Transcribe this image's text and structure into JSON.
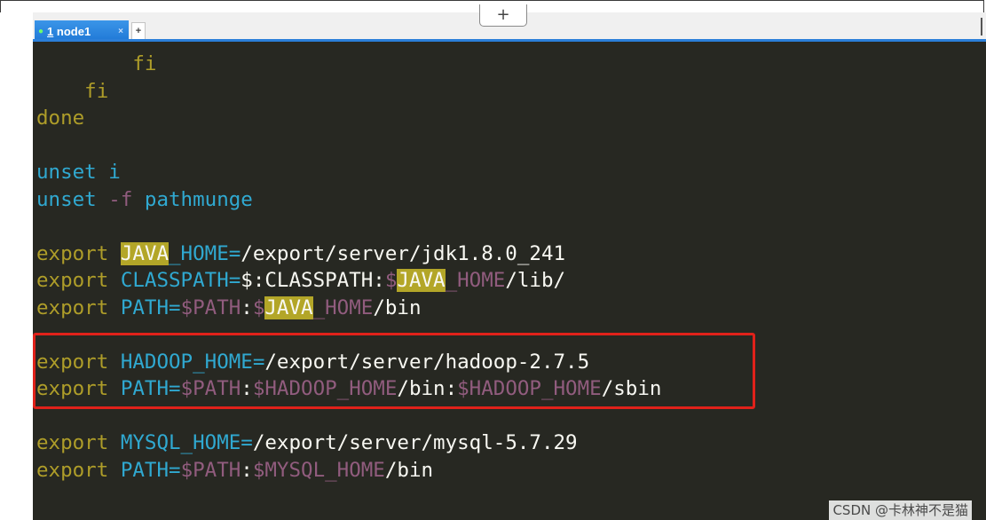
{
  "tabs": [
    {
      "number": "1",
      "name": " node1",
      "close": "×",
      "active": true
    }
  ],
  "new_tab_label": "+",
  "add_pane_label": "+",
  "terminal": {
    "lines": [
      [
        {
          "t": "        fi",
          "c": "kw"
        }
      ],
      [
        {
          "t": "    fi",
          "c": "kw"
        }
      ],
      [
        {
          "t": "done",
          "c": "kw"
        }
      ],
      [
        {
          "t": "",
          "c": "val"
        }
      ],
      [
        {
          "t": "unset ",
          "c": "cmd"
        },
        {
          "t": "i",
          "c": "cmd"
        }
      ],
      [
        {
          "t": "unset ",
          "c": "cmd"
        },
        {
          "t": "-f",
          "c": "var"
        },
        {
          "t": " pathmunge",
          "c": "cmd"
        }
      ],
      [
        {
          "t": "",
          "c": "val"
        }
      ],
      [
        {
          "t": "export ",
          "c": "kw"
        },
        {
          "t": "JAVA",
          "c": "hl"
        },
        {
          "t": "_HOME=",
          "c": "cmd"
        },
        {
          "t": "/export/server/jdk1.8.0_241",
          "c": "val"
        }
      ],
      [
        {
          "t": "export ",
          "c": "kw"
        },
        {
          "t": "CLASSPATH=",
          "c": "cmd"
        },
        {
          "t": "$:CLASSPATH:",
          "c": "val"
        },
        {
          "t": "$",
          "c": "var"
        },
        {
          "t": "JAVA",
          "c": "hl"
        },
        {
          "t": "_HOME",
          "c": "var"
        },
        {
          "t": "/lib/",
          "c": "val"
        }
      ],
      [
        {
          "t": "export ",
          "c": "kw"
        },
        {
          "t": "PATH=",
          "c": "cmd"
        },
        {
          "t": "$PATH",
          "c": "var"
        },
        {
          "t": ":",
          "c": "val"
        },
        {
          "t": "$",
          "c": "var"
        },
        {
          "t": "JAVA",
          "c": "hl"
        },
        {
          "t": "_HOME",
          "c": "var"
        },
        {
          "t": "/bin",
          "c": "val"
        }
      ],
      [
        {
          "t": "",
          "c": "val"
        }
      ],
      [
        {
          "t": "export ",
          "c": "kw"
        },
        {
          "t": "HADOOP_HOME=",
          "c": "cmd"
        },
        {
          "t": "/export/server/hadoop-2.7.5",
          "c": "val"
        }
      ],
      [
        {
          "t": "export ",
          "c": "kw"
        },
        {
          "t": "PATH=",
          "c": "cmd"
        },
        {
          "t": "$PATH",
          "c": "var"
        },
        {
          "t": ":",
          "c": "val"
        },
        {
          "t": "$HADOOP_HOME",
          "c": "var"
        },
        {
          "t": "/bin:",
          "c": "val"
        },
        {
          "t": "$HADOOP_HOME",
          "c": "var"
        },
        {
          "t": "/sbin",
          "c": "val"
        }
      ],
      [
        {
          "t": "",
          "c": "val"
        }
      ],
      [
        {
          "t": "export ",
          "c": "kw"
        },
        {
          "t": "MYSQL_HOME=",
          "c": "cmd"
        },
        {
          "t": "/export/server/mysql-5.7.29",
          "c": "val"
        }
      ],
      [
        {
          "t": "export ",
          "c": "kw"
        },
        {
          "t": "PATH=",
          "c": "cmd"
        },
        {
          "t": "$PATH",
          "c": "var"
        },
        {
          "t": ":",
          "c": "val"
        },
        {
          "t": "$MYSQL_HOME",
          "c": "var"
        },
        {
          "t": "/bin",
          "c": "val"
        }
      ]
    ]
  },
  "colors": {
    "terminal_bg": "#272822",
    "keyword": "#ae9d29",
    "command": "#30a9d1",
    "variable": "#915c7e",
    "search_highlight": "#b3a628",
    "annotation_box": "#e0211a",
    "tab_active": "#2b7fd9"
  },
  "watermark": "CSDN @卡林神不是猫"
}
